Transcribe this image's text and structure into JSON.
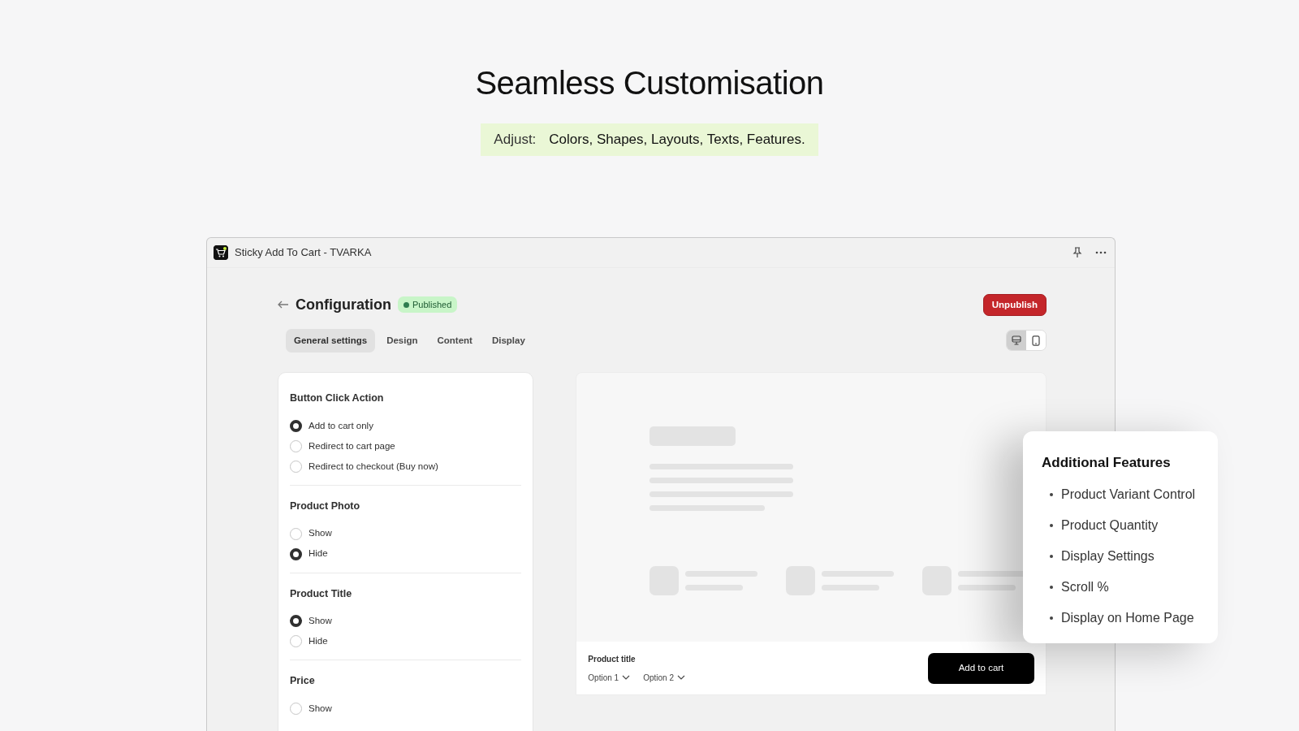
{
  "hero": {
    "title": "Seamless Customisation",
    "adjust_label": "Adjust:",
    "adjust_items": "Colors, Shapes, Layouts, Texts, Features."
  },
  "window": {
    "title": "Sticky Add To Cart - TVARKA"
  },
  "page": {
    "title": "Configuration",
    "status": "Published",
    "action": "Unpublish"
  },
  "tabs": [
    {
      "label": "General settings",
      "selected": true
    },
    {
      "label": "Design",
      "selected": false
    },
    {
      "label": "Content",
      "selected": false
    },
    {
      "label": "Display",
      "selected": false
    }
  ],
  "view_toggle": [
    {
      "kind": "desktop",
      "selected": true
    },
    {
      "kind": "mobile",
      "selected": false
    }
  ],
  "groups": [
    {
      "title": "Button Click Action",
      "options": [
        {
          "label": "Add to cart only",
          "selected": true
        },
        {
          "label": "Redirect to cart page",
          "selected": false
        },
        {
          "label": "Redirect to checkout (Buy now)",
          "selected": false
        }
      ]
    },
    {
      "title": "Product Photo",
      "options": [
        {
          "label": "Show",
          "selected": false
        },
        {
          "label": "Hide",
          "selected": true
        }
      ]
    },
    {
      "title": "Product Title",
      "options": [
        {
          "label": "Show",
          "selected": true
        },
        {
          "label": "Hide",
          "selected": false
        }
      ]
    },
    {
      "title": "Price",
      "options": [
        {
          "label": "Show",
          "selected": false
        }
      ]
    }
  ],
  "sticky_bar": {
    "product_title": "Product title",
    "options": [
      "Option 1",
      "Option 2"
    ],
    "button": "Add to cart"
  },
  "features": {
    "title": "Additional Features",
    "items": [
      "Product Variant Control",
      "Product Quantity",
      "Display Settings",
      "Scroll %",
      "Display on Home Page"
    ]
  }
}
